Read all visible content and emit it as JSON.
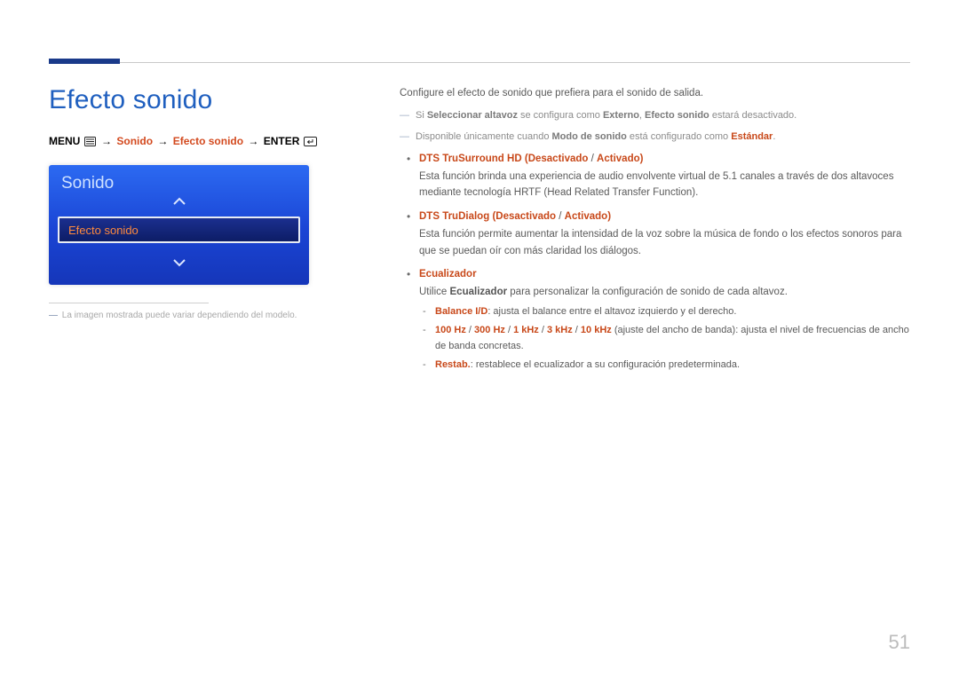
{
  "title": "Efecto sonido",
  "breadcrumb": {
    "menu": "MENU",
    "path1": "Sonido",
    "path2": "Efecto sonido",
    "enter": "ENTER"
  },
  "menu_shot": {
    "header": "Sonido",
    "selected": "Efecto sonido"
  },
  "left_footnote": "La imagen mostrada puede variar dependiendo del modelo.",
  "intro": "Configure el efecto de sonido que prefiera para el sonido de salida.",
  "note1": {
    "pre": "Si ",
    "b1": "Seleccionar altavoz",
    "mid": " se configura como ",
    "b2": "Externo",
    "mid2": ", ",
    "b3": "Efecto sonido",
    "post": " estará desactivado."
  },
  "note2": {
    "pre": "Disponible únicamente cuando ",
    "b1": "Modo de sonido",
    "mid": " está configurado como ",
    "b2": "Estándar",
    "post": "."
  },
  "items": [
    {
      "name": "DTS TruSurround HD",
      "opt_off": "Desactivado",
      "opt_on": "Activado",
      "body": "Esta función brinda una experiencia de audio envolvente virtual de 5.1 canales a través de dos altavoces mediante tecnología HRTF (Head Related Transfer Function)."
    },
    {
      "name": "DTS TruDialog",
      "opt_off": "Desactivado",
      "opt_on": "Activado",
      "body": "Esta función permite aumentar la intensidad de la voz sobre la música de fondo o los efectos sonoros para que se puedan oír con más claridad los diálogos."
    },
    {
      "name": "Ecualizador",
      "body_pre": "Utilice ",
      "body_b": "Ecualizador",
      "body_post": " para personalizar la configuración de sonido de cada altavoz.",
      "subs": [
        {
          "b": "Balance I/D",
          "txt": ": ajusta el balance entre el altavoz izquierdo y el derecho."
        },
        {
          "parts": [
            "100 Hz",
            " / ",
            "300 Hz",
            " / ",
            "1 kHz",
            " / ",
            "3 kHz",
            " / ",
            "10 kHz"
          ],
          "txt": " (ajuste del ancho de banda): ajusta el nivel de frecuencias de ancho de banda concretas."
        },
        {
          "b": "Restab.",
          "txt": ": restablece el ecualizador a su configuración predeterminada."
        }
      ]
    }
  ],
  "page_number": "51"
}
